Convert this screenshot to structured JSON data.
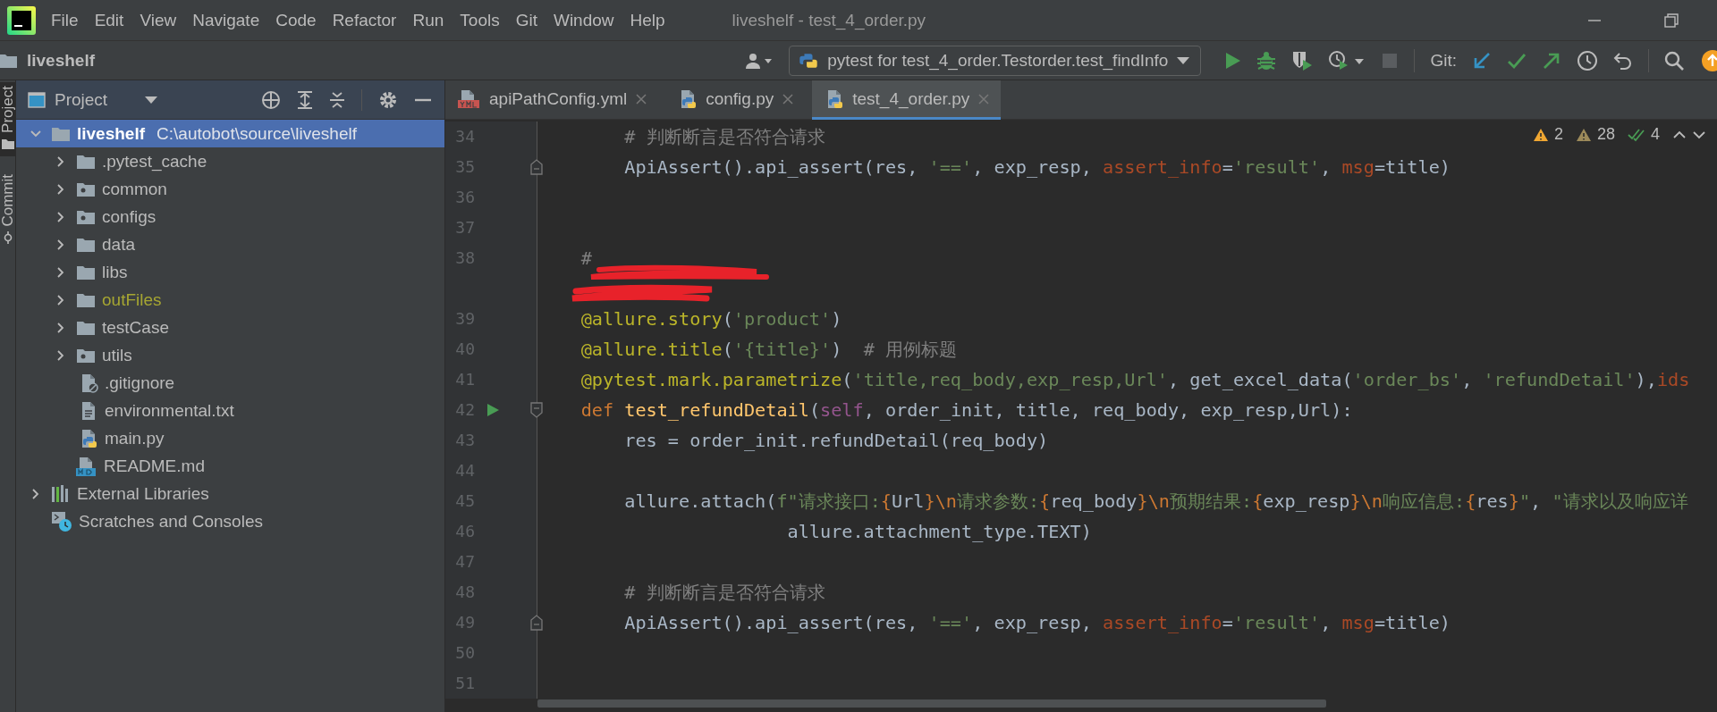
{
  "window": {
    "title": "liveshelf - test_4_order.py",
    "menu": [
      "File",
      "Edit",
      "View",
      "Navigate",
      "Code",
      "Refactor",
      "Run",
      "Tools",
      "Git",
      "Window",
      "Help"
    ]
  },
  "navbar": {
    "project": "liveshelf",
    "run_config": "pytest for test_4_order.Testorder.test_findInfo",
    "git_label": "Git:",
    "stop_enabled": false
  },
  "side_stripe": [
    {
      "label": "Project",
      "kind": "project",
      "selected": true
    },
    {
      "label": "Commit",
      "kind": "commit",
      "selected": false
    }
  ],
  "project_panel": {
    "title": "Project",
    "tree": [
      {
        "name": "liveshelf",
        "path": "C:\\autobot\\source\\liveshelf",
        "kind": "project",
        "expanded": true,
        "selected": true,
        "excluded": false,
        "children": [
          {
            "name": ".pytest_cache",
            "kind": "folder",
            "expanded": false,
            "selected": false,
            "excluded": false
          },
          {
            "name": "common",
            "kind": "module",
            "expanded": false,
            "selected": false,
            "excluded": false
          },
          {
            "name": "configs",
            "kind": "module",
            "expanded": false,
            "selected": false,
            "excluded": false
          },
          {
            "name": "data",
            "kind": "folder",
            "expanded": false,
            "selected": false,
            "excluded": false
          },
          {
            "name": "libs",
            "kind": "folder",
            "expanded": false,
            "selected": false,
            "excluded": false
          },
          {
            "name": "outFiles",
            "kind": "folder",
            "expanded": false,
            "selected": false,
            "excluded": true
          },
          {
            "name": "testCase",
            "kind": "folder",
            "expanded": false,
            "selected": false,
            "excluded": false
          },
          {
            "name": "utils",
            "kind": "module",
            "expanded": false,
            "selected": false,
            "excluded": false
          },
          {
            "name": ".gitignore",
            "kind": "ignore",
            "selected": false,
            "excluded": false
          },
          {
            "name": "environmental.txt",
            "kind": "text",
            "selected": false,
            "excluded": false
          },
          {
            "name": "main.py",
            "kind": "python",
            "selected": false,
            "excluded": false
          },
          {
            "name": "README.md",
            "kind": "markdown",
            "selected": false,
            "excluded": false
          }
        ]
      },
      {
        "name": "External Libraries",
        "kind": "libraries",
        "expanded": false,
        "selected": false,
        "excluded": false
      },
      {
        "name": "Scratches and Consoles",
        "kind": "scratches",
        "selected": false,
        "excluded": false
      }
    ]
  },
  "editor": {
    "tabs": [
      {
        "label": "apiPathConfig.yml",
        "kind": "yml",
        "selected": false
      },
      {
        "label": "config.py",
        "kind": "python",
        "selected": false
      },
      {
        "label": "test_4_order.py",
        "kind": "python",
        "selected": true
      }
    ],
    "inspections": {
      "errors": "2",
      "warnings": "28",
      "typos": "4"
    },
    "lines": [
      {
        "number": "34",
        "tokens": [
          {
            "kind": "comment",
            "text": "        # 判断断言是否符合请求"
          }
        ]
      },
      {
        "number": "35",
        "fold": {
          "kind": "end"
        },
        "tokens": [
          {
            "kind": "plain",
            "text": "        ApiAssert().api_assert(res, "
          },
          {
            "kind": "string",
            "text": "'=='"
          },
          {
            "kind": "plain",
            "text": ", exp_resp, "
          },
          {
            "kind": "arg",
            "text": "assert_info"
          },
          {
            "kind": "plain",
            "text": "="
          },
          {
            "kind": "string",
            "text": "'result'"
          },
          {
            "kind": "plain",
            "text": ", "
          },
          {
            "kind": "arg",
            "text": "msg"
          },
          {
            "kind": "plain",
            "text": "=title)"
          }
        ]
      },
      {
        "number": "36"
      },
      {
        "number": "37"
      },
      {
        "number": "38",
        "redacted": true,
        "tokens": [
          {
            "kind": "comment",
            "text": "    #"
          }
        ]
      },
      {
        "number": "39",
        "tokens": [
          {
            "kind": "decorator",
            "text": "    @allure.story"
          },
          {
            "kind": "plain",
            "text": "("
          },
          {
            "kind": "string",
            "text": "'product'"
          },
          {
            "kind": "plain",
            "text": ")"
          }
        ]
      },
      {
        "number": "40",
        "tokens": [
          {
            "kind": "decorator",
            "text": "    @allure.title"
          },
          {
            "kind": "plain",
            "text": "("
          },
          {
            "kind": "string",
            "text": "'{title}'"
          },
          {
            "kind": "plain",
            "text": ")  "
          },
          {
            "kind": "comment",
            "text": "# 用例标题"
          }
        ]
      },
      {
        "number": "41",
        "tokens": [
          {
            "kind": "decorator",
            "text": "    @pytest.mark.parametrize"
          },
          {
            "kind": "plain",
            "text": "("
          },
          {
            "kind": "string",
            "text": "'title,req_body,exp_resp,Url'"
          },
          {
            "kind": "plain",
            "text": ", get_excel_data("
          },
          {
            "kind": "string",
            "text": "'order_bs'"
          },
          {
            "kind": "plain",
            "text": ", "
          },
          {
            "kind": "string",
            "text": "'refundDetail'"
          },
          {
            "kind": "plain",
            "text": "),"
          },
          {
            "kind": "arg",
            "text": "ids"
          }
        ]
      },
      {
        "number": "42",
        "run": true,
        "fold": {
          "kind": "start"
        },
        "tokens": [
          {
            "kind": "keyword",
            "text": "    def "
          },
          {
            "kind": "function",
            "text": "test_refundDetail"
          },
          {
            "kind": "plain",
            "text": "("
          },
          {
            "kind": "self",
            "text": "self"
          },
          {
            "kind": "plain",
            "text": ", order_init, title, req_body, exp_resp,Url):"
          }
        ]
      },
      {
        "number": "43",
        "tokens": [
          {
            "kind": "plain",
            "text": "        res = order_init.refundDetail(req_body)"
          }
        ]
      },
      {
        "number": "44"
      },
      {
        "number": "45",
        "tokens": [
          {
            "kind": "plain",
            "text": "        allure.attach("
          },
          {
            "kind": "string",
            "text": "f\"请求接口:"
          },
          {
            "kind": "keyword",
            "text": "{"
          },
          {
            "kind": "plain",
            "text": "Url"
          },
          {
            "kind": "keyword",
            "text": "}\\n"
          },
          {
            "kind": "string",
            "text": "请求参数:"
          },
          {
            "kind": "keyword",
            "text": "{"
          },
          {
            "kind": "plain",
            "text": "req_body"
          },
          {
            "kind": "keyword",
            "text": "}\\n"
          },
          {
            "kind": "string",
            "text": "预期结果:"
          },
          {
            "kind": "keyword",
            "text": "{"
          },
          {
            "kind": "plain",
            "text": "exp_resp"
          },
          {
            "kind": "keyword",
            "text": "}\\n"
          },
          {
            "kind": "string",
            "text": "响应信息:"
          },
          {
            "kind": "keyword",
            "text": "{"
          },
          {
            "kind": "plain",
            "text": "res"
          },
          {
            "kind": "keyword",
            "text": "}"
          },
          {
            "kind": "string",
            "text": "\""
          },
          {
            "kind": "plain",
            "text": ", "
          },
          {
            "kind": "string",
            "text": "\"请求以及响应详"
          }
        ]
      },
      {
        "number": "46",
        "tokens": [
          {
            "kind": "plain",
            "text": "                       allure.attachment_type.TEXT)"
          }
        ]
      },
      {
        "number": "47"
      },
      {
        "number": "48",
        "tokens": [
          {
            "kind": "comment",
            "text": "        # 判断断言是否符合请求"
          }
        ]
      },
      {
        "number": "49",
        "fold": {
          "kind": "end"
        },
        "tokens": [
          {
            "kind": "plain",
            "text": "        ApiAssert().api_assert(res, "
          },
          {
            "kind": "string",
            "text": "'=='"
          },
          {
            "kind": "plain",
            "text": ", exp_resp, "
          },
          {
            "kind": "arg",
            "text": "assert_info"
          },
          {
            "kind": "plain",
            "text": "="
          },
          {
            "kind": "string",
            "text": "'result'"
          },
          {
            "kind": "plain",
            "text": ", "
          },
          {
            "kind": "arg",
            "text": "msg"
          },
          {
            "kind": "plain",
            "text": "=title)"
          }
        ]
      },
      {
        "number": "50"
      },
      {
        "number": "51"
      }
    ]
  }
}
